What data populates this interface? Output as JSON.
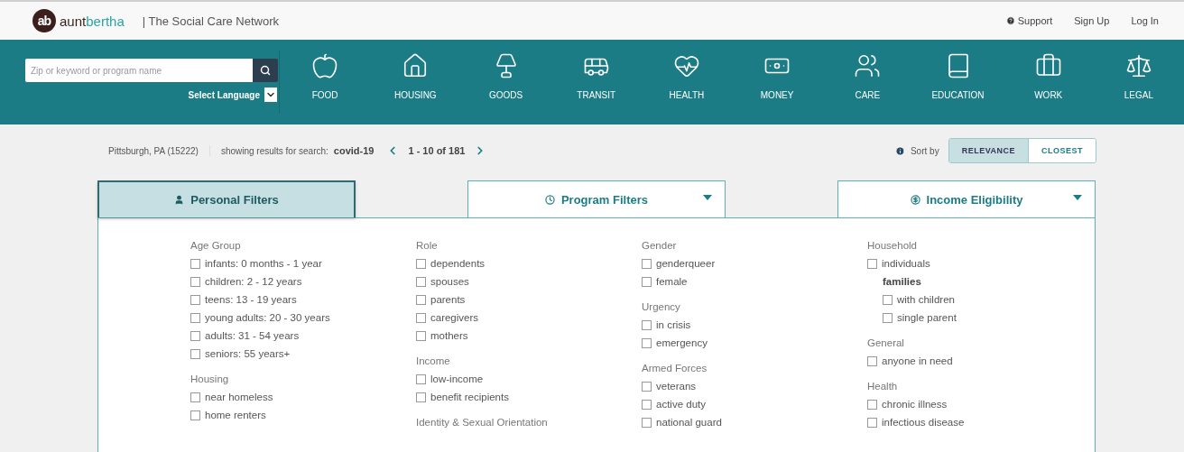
{
  "header": {
    "logo": {
      "mark": "ab",
      "part1": "aunt",
      "part2": "bertha"
    },
    "tagline": "| The Social Care Network",
    "links": [
      {
        "label": "Support",
        "kind": "help"
      },
      {
        "label": "Sign Up",
        "kind": "plain"
      },
      {
        "label": "Log In",
        "kind": "plain"
      }
    ]
  },
  "search": {
    "placeholder": "Zip or keyword or program name",
    "language": "Select Language"
  },
  "categories": [
    {
      "label": "FOOD"
    },
    {
      "label": "HOUSING"
    },
    {
      "label": "GOODS"
    },
    {
      "label": "TRANSIT"
    },
    {
      "label": "HEALTH"
    },
    {
      "label": "MONEY"
    },
    {
      "label": "CARE"
    },
    {
      "label": "EDUCATION"
    },
    {
      "label": "WORK"
    },
    {
      "label": "LEGAL"
    }
  ],
  "results": {
    "location": "Pittsburgh, PA (15222)",
    "search_label": "showing results for search:",
    "query": "covid-19",
    "range": "1 - 10 of 181",
    "sort_label": "Sort by",
    "sort_options": [
      {
        "label": "RELEVANCE",
        "selected": true
      },
      {
        "label": "CLOSEST",
        "selected": false
      }
    ]
  },
  "filter_tabs": [
    {
      "label": "Personal Filters",
      "kind": "person",
      "selected": true,
      "dropdown": false
    },
    {
      "label": "Program Filters",
      "kind": "clock",
      "selected": false,
      "dropdown": true
    },
    {
      "label": "Income Eligibility",
      "kind": "income",
      "selected": false,
      "dropdown": true
    }
  ],
  "columns": [
    {
      "groups": [
        {
          "title": "Age Group",
          "items": [
            {
              "label": "infants: 0 months - 1 year",
              "checked": false
            },
            {
              "label": "children: 2 - 12 years",
              "checked": false
            },
            {
              "label": "teens: 13 - 19 years",
              "checked": false
            },
            {
              "label": "young adults: 20 - 30 years",
              "checked": false
            },
            {
              "label": "adults: 31 - 54 years",
              "checked": false
            },
            {
              "label": "seniors: 55 years+",
              "checked": false
            }
          ]
        },
        {
          "title": "Housing",
          "items": [
            {
              "label": "near homeless",
              "checked": false
            },
            {
              "label": "home renters",
              "checked": false
            }
          ]
        }
      ]
    },
    {
      "groups": [
        {
          "title": "Role",
          "items": [
            {
              "label": "dependents",
              "checked": false
            },
            {
              "label": "spouses",
              "checked": false
            },
            {
              "label": "parents",
              "checked": false
            },
            {
              "label": "caregivers",
              "checked": false
            },
            {
              "label": "mothers",
              "checked": false
            }
          ]
        },
        {
          "title": "Income",
          "items": [
            {
              "label": "low-income",
              "checked": false
            },
            {
              "label": "benefit recipients",
              "checked": false
            }
          ]
        },
        {
          "title": "Identity & Sexual Orientation"
        }
      ]
    },
    {
      "groups": [
        {
          "title": "Gender",
          "items": [
            {
              "label": "genderqueer",
              "checked": false
            },
            {
              "label": "female",
              "checked": false
            }
          ]
        },
        {
          "title": "Urgency",
          "items": [
            {
              "label": "in crisis",
              "checked": false
            },
            {
              "label": "emergency",
              "checked": false
            }
          ]
        },
        {
          "title": "Armed Forces",
          "items": [
            {
              "label": "veterans",
              "checked": false
            },
            {
              "label": "active duty",
              "checked": false
            },
            {
              "label": "national guard",
              "checked": false
            }
          ]
        }
      ]
    },
    {
      "groups": [
        {
          "title": "Household",
          "items": [
            {
              "kind": "option",
              "label": "individuals",
              "checked": false
            },
            {
              "kind": "subgroup",
              "label": "families",
              "children": [
                {
                  "label": "with children",
                  "checked": false
                },
                {
                  "label": "single parent",
                  "checked": false
                }
              ]
            }
          ]
        },
        {
          "title": "General",
          "items": [
            {
              "kind": "option",
              "label": "anyone in need",
              "checked": false
            }
          ]
        },
        {
          "title": "Health",
          "items": [
            {
              "kind": "option",
              "label": "chronic illness",
              "checked": false
            },
            {
              "kind": "option",
              "label": "infectious disease",
              "checked": false
            }
          ]
        }
      ]
    }
  ]
}
